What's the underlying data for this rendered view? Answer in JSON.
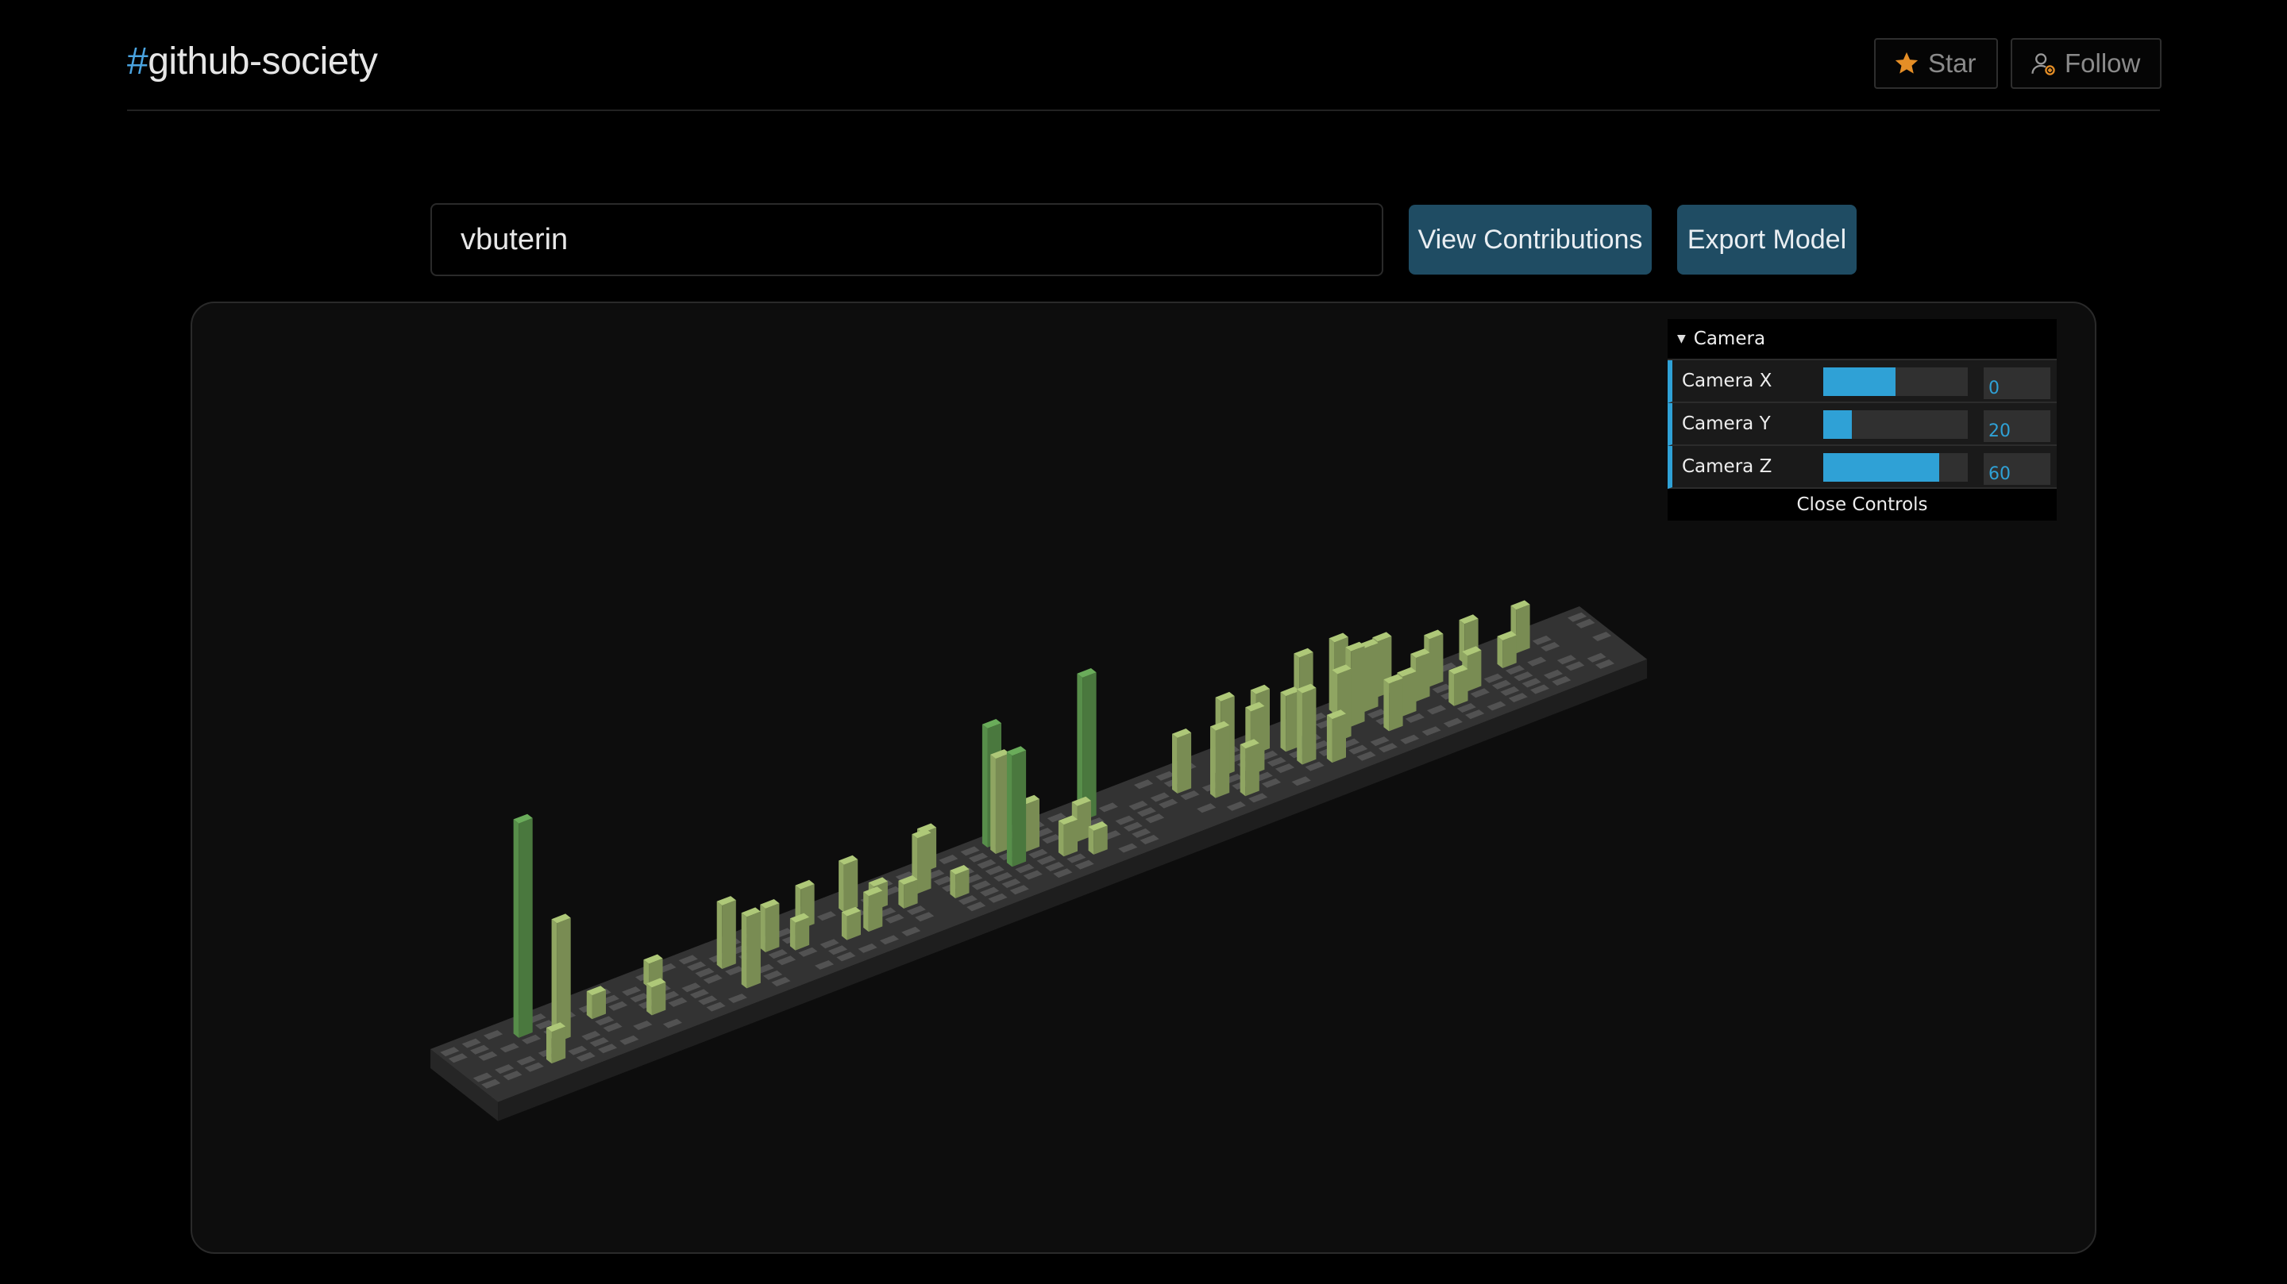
{
  "header": {
    "hash": "#",
    "title": "github-society",
    "star_label": "Star",
    "follow_label": "Follow"
  },
  "search": {
    "value": "vbuterin"
  },
  "actions": {
    "view_label": "View Contributions",
    "export_label": "Export Model"
  },
  "controls": {
    "folder_title": "Camera",
    "rows": [
      {
        "label": "Camera X",
        "value": "0",
        "fill": 0.5
      },
      {
        "label": "Camera Y",
        "value": "20",
        "fill": 0.2
      },
      {
        "label": "Camera Z",
        "value": "60",
        "fill": 0.8
      }
    ],
    "close_label": "Close Controls"
  },
  "colors": {
    "accent": "#4aa3df",
    "button_bg": "#1f4c63",
    "slider": "#2fa1d6",
    "star_icon": "#e58e26",
    "bar_light": "#9bb36b",
    "bar_dark": "#5f9a50",
    "base": "#333333",
    "cell": "#525252"
  },
  "icons": {
    "star": "star-icon",
    "follow": "person-add-icon"
  }
}
